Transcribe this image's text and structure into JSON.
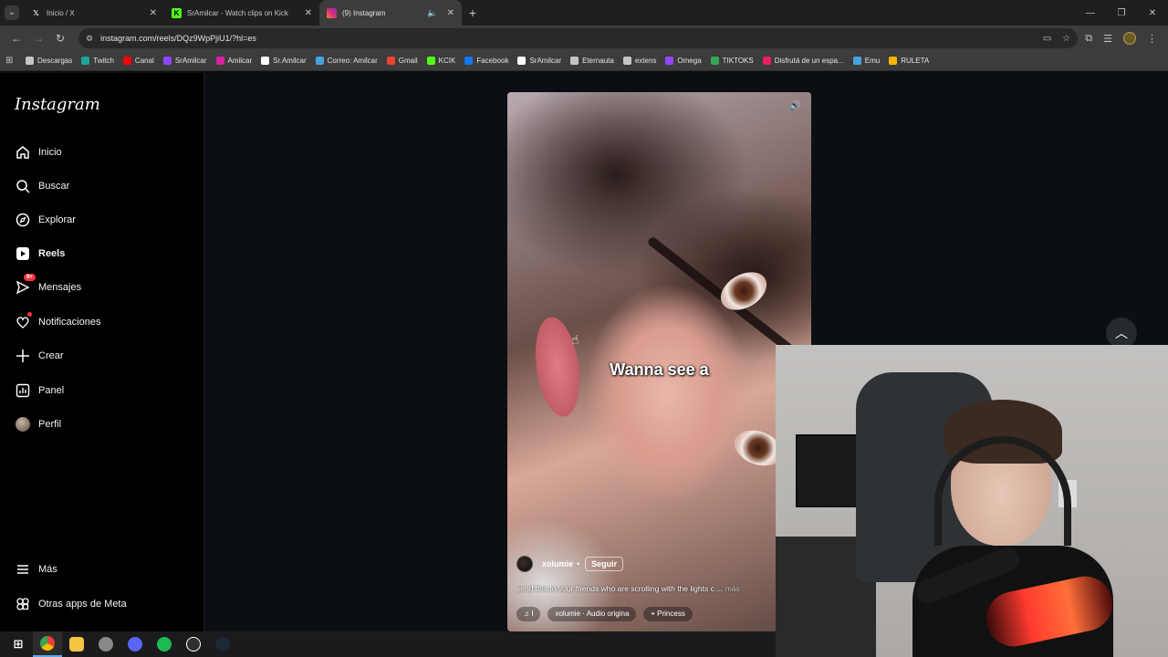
{
  "browser": {
    "tabs": [
      {
        "title": "Inicio / X",
        "icon": "x-icon",
        "active": false
      },
      {
        "title": "SrAmilcar - Watch clips on Kick",
        "icon": "kick-icon",
        "active": false
      },
      {
        "title": "(9) Instagram",
        "icon": "instagram-icon",
        "active": true
      }
    ],
    "url": "instagram.com/reels/DQz9WpPjiU1/?hl=es",
    "bookmarks": [
      {
        "label": "Descargas",
        "icon": "download-icon",
        "color": "#c4c7c5"
      },
      {
        "label": "Twitch",
        "icon": "twitch-icon",
        "color": "#1fa39a"
      },
      {
        "label": "Canal",
        "icon": "youtube-icon",
        "color": "#ff0000"
      },
      {
        "label": "SrAmilcar",
        "icon": "twitch-icon",
        "color": "#9146ff"
      },
      {
        "label": "Amilcar",
        "icon": "instagram-icon",
        "color": "#d6249f"
      },
      {
        "label": "Sr.Amilcar",
        "icon": "x-icon",
        "color": "#ffffff"
      },
      {
        "label": "Correo: Amilcar",
        "icon": "outlook-icon",
        "color": "#4aa3e0"
      },
      {
        "label": "Gmail",
        "icon": "gmail-icon",
        "color": "#ea4335"
      },
      {
        "label": "KCIK",
        "icon": "kick-icon",
        "color": "#53fc18"
      },
      {
        "label": "Facebook",
        "icon": "facebook-icon",
        "color": "#1877f2"
      },
      {
        "label": "SrAmilcar",
        "icon": "tiktok-icon",
        "color": "#ffffff"
      },
      {
        "label": "Eternauta",
        "icon": "doc-icon",
        "color": "#c4c7c5"
      },
      {
        "label": "extens",
        "icon": "extension-icon",
        "color": "#c4c7c5"
      },
      {
        "label": "Omega",
        "icon": "twitch-icon",
        "color": "#9146ff"
      },
      {
        "label": "TIKTOKS",
        "icon": "drive-icon",
        "color": "#34a853"
      },
      {
        "label": "Disfrutá de un espa...",
        "icon": "bookmark-icon",
        "color": "#e91e63"
      },
      {
        "label": "Emu",
        "icon": "emu-icon",
        "color": "#4aa3e0"
      },
      {
        "label": "RULETA",
        "icon": "ruleta-icon",
        "color": "#f4b400"
      }
    ]
  },
  "instagram": {
    "logo": "Instagram",
    "nav": [
      {
        "label": "Inicio",
        "icon": "home-icon",
        "bold": false
      },
      {
        "label": "Buscar",
        "icon": "search-icon",
        "bold": false
      },
      {
        "label": "Explorar",
        "icon": "compass-icon",
        "bold": false
      },
      {
        "label": "Reels",
        "icon": "reels-icon",
        "bold": true
      },
      {
        "label": "Mensajes",
        "icon": "messenger-icon",
        "bold": false,
        "badge": "9+"
      },
      {
        "label": "Notificaciones",
        "icon": "heart-icon",
        "bold": false,
        "dot": true
      },
      {
        "label": "Crear",
        "icon": "plus-icon",
        "bold": false
      },
      {
        "label": "Panel",
        "icon": "dashboard-icon",
        "bold": false
      },
      {
        "label": "Perfil",
        "icon": "profile-icon",
        "bold": false
      }
    ],
    "bottom_nav": [
      {
        "label": "Más",
        "icon": "menu-icon"
      },
      {
        "label": "Otras apps de Meta",
        "icon": "meta-apps-icon"
      }
    ]
  },
  "reel": {
    "caption_overlay": "Wanna see a",
    "username": "xolumie",
    "separator": "•",
    "follow_label": "Seguir",
    "description": "send this to your friends who are scrolling with the lights c ...",
    "more_label": "más",
    "audio_mark": "I",
    "audio": "xolumie · Audio origina",
    "location": "Princess"
  },
  "taskbar": {
    "icons": [
      "windows-icon",
      "chrome-icon",
      "file-explorer-icon",
      "app-icon",
      "discord-icon",
      "spotify-icon",
      "obs-icon",
      "steam-icon"
    ]
  }
}
